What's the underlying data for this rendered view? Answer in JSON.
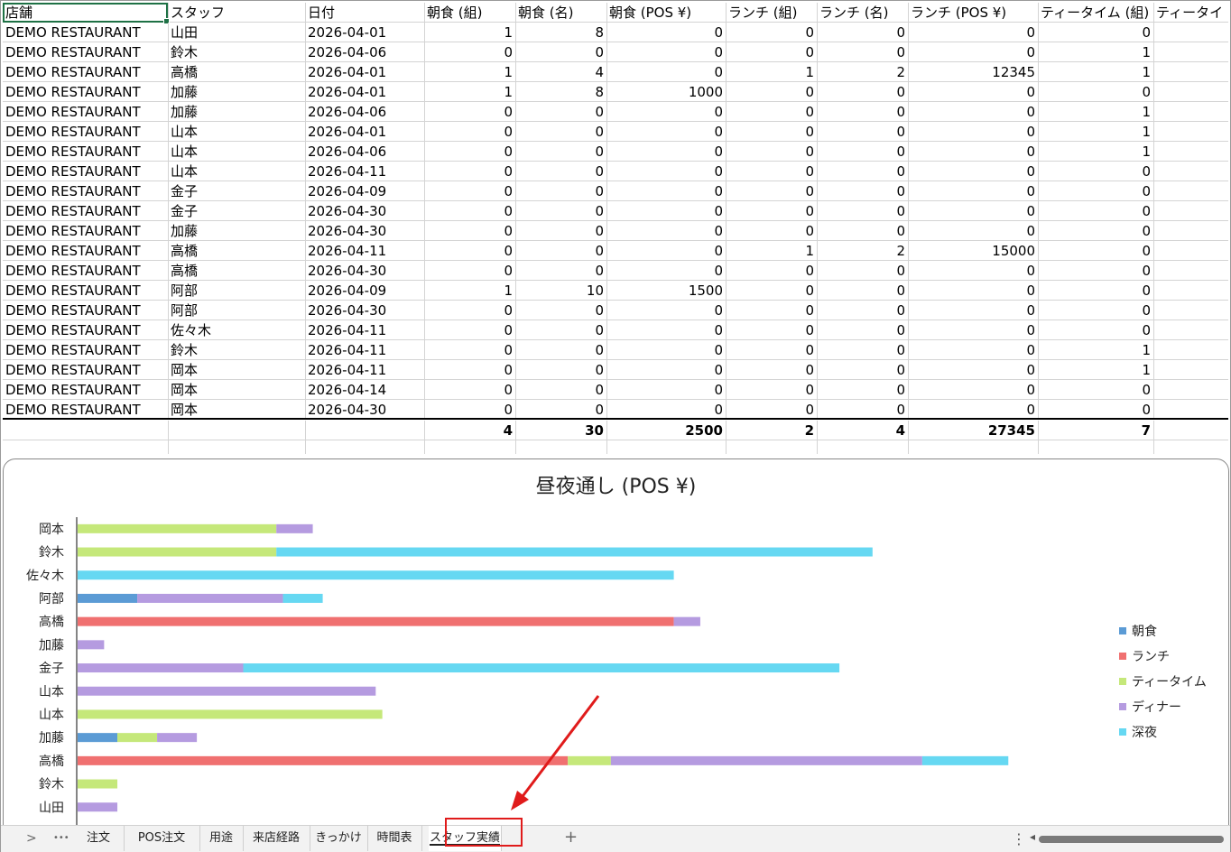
{
  "sheet": {
    "headers": [
      "店舗",
      "スタッフ",
      "日付",
      "朝食 (組)",
      "朝食 (名)",
      "朝食 (POS ¥)",
      "ランチ (組)",
      "ランチ (名)",
      "ランチ (POS ¥)",
      "ティータイム (組)",
      "ティータイ"
    ],
    "rows": [
      [
        "DEMO RESTAURANT",
        "山田",
        "2026-04-01",
        "1",
        "8",
        "0",
        "0",
        "0",
        "0",
        "0"
      ],
      [
        "DEMO RESTAURANT",
        "鈴木",
        "2026-04-06",
        "0",
        "0",
        "0",
        "0",
        "0",
        "0",
        "1"
      ],
      [
        "DEMO RESTAURANT",
        "高橋",
        "2026-04-01",
        "1",
        "4",
        "0",
        "1",
        "2",
        "12345",
        "1"
      ],
      [
        "DEMO RESTAURANT",
        "加藤",
        "2026-04-01",
        "1",
        "8",
        "1000",
        "0",
        "0",
        "0",
        "0"
      ],
      [
        "DEMO RESTAURANT",
        "加藤",
        "2026-04-06",
        "0",
        "0",
        "0",
        "0",
        "0",
        "0",
        "1"
      ],
      [
        "DEMO RESTAURANT",
        "山本",
        "2026-04-01",
        "0",
        "0",
        "0",
        "0",
        "0",
        "0",
        "1"
      ],
      [
        "DEMO RESTAURANT",
        "山本",
        "2026-04-06",
        "0",
        "0",
        "0",
        "0",
        "0",
        "0",
        "1"
      ],
      [
        "DEMO RESTAURANT",
        "山本",
        "2026-04-11",
        "0",
        "0",
        "0",
        "0",
        "0",
        "0",
        "0"
      ],
      [
        "DEMO RESTAURANT",
        "金子",
        "2026-04-09",
        "0",
        "0",
        "0",
        "0",
        "0",
        "0",
        "0"
      ],
      [
        "DEMO RESTAURANT",
        "金子",
        "2026-04-30",
        "0",
        "0",
        "0",
        "0",
        "0",
        "0",
        "0"
      ],
      [
        "DEMO RESTAURANT",
        "加藤",
        "2026-04-30",
        "0",
        "0",
        "0",
        "0",
        "0",
        "0",
        "0"
      ],
      [
        "DEMO RESTAURANT",
        "高橋",
        "2026-04-11",
        "0",
        "0",
        "0",
        "1",
        "2",
        "15000",
        "0"
      ],
      [
        "DEMO RESTAURANT",
        "高橋",
        "2026-04-30",
        "0",
        "0",
        "0",
        "0",
        "0",
        "0",
        "0"
      ],
      [
        "DEMO RESTAURANT",
        "阿部",
        "2026-04-09",
        "1",
        "10",
        "1500",
        "0",
        "0",
        "0",
        "0"
      ],
      [
        "DEMO RESTAURANT",
        "阿部",
        "2026-04-30",
        "0",
        "0",
        "0",
        "0",
        "0",
        "0",
        "0"
      ],
      [
        "DEMO RESTAURANT",
        "佐々木",
        "2026-04-11",
        "0",
        "0",
        "0",
        "0",
        "0",
        "0",
        "0"
      ],
      [
        "DEMO RESTAURANT",
        "鈴木",
        "2026-04-11",
        "0",
        "0",
        "0",
        "0",
        "0",
        "0",
        "1"
      ],
      [
        "DEMO RESTAURANT",
        "岡本",
        "2026-04-11",
        "0",
        "0",
        "0",
        "0",
        "0",
        "0",
        "1"
      ],
      [
        "DEMO RESTAURANT",
        "岡本",
        "2026-04-14",
        "0",
        "0",
        "0",
        "0",
        "0",
        "0",
        "0"
      ],
      [
        "DEMO RESTAURANT",
        "岡本",
        "2026-04-30",
        "0",
        "0",
        "0",
        "0",
        "0",
        "0",
        "0"
      ]
    ],
    "totals": [
      "4",
      "30",
      "2500",
      "2",
      "4",
      "27345",
      "7"
    ]
  },
  "chart_data": {
    "type": "bar",
    "orientation": "horizontal",
    "stacked": true,
    "title": "昼夜通し (POS ¥)",
    "categories": [
      "岡本",
      "鈴木",
      "佐々木",
      "阿部",
      "高橋",
      "加藤",
      "金子",
      "山本",
      "山本",
      "加藤",
      "高橋",
      "鈴木",
      "山田"
    ],
    "series": [
      {
        "name": "朝食",
        "color": "#5b9bd5",
        "values": [
          0,
          0,
          0,
          900,
          0,
          0,
          0,
          0,
          0,
          600,
          0,
          0,
          0
        ]
      },
      {
        "name": "ランチ",
        "color": "#f07070",
        "values": [
          0,
          0,
          0,
          0,
          9000,
          0,
          0,
          0,
          0,
          0,
          7400,
          0,
          0
        ]
      },
      {
        "name": "ティータイム",
        "color": "#c5e87a",
        "values": [
          3000,
          3000,
          0,
          0,
          0,
          0,
          0,
          0,
          4600,
          600,
          650,
          600,
          0
        ]
      },
      {
        "name": "ディナー",
        "color": "#b59be0",
        "values": [
          550,
          0,
          0,
          2200,
          400,
          400,
          2500,
          4500,
          0,
          600,
          4700,
          0,
          600
        ]
      },
      {
        "name": "深夜",
        "color": "#66d8f2",
        "values": [
          0,
          9000,
          9000,
          600,
          0,
          0,
          9000,
          0,
          0,
          0,
          1300,
          0,
          0
        ]
      }
    ],
    "xlim": [
      0,
      15000
    ],
    "grid": false,
    "legend": "right"
  },
  "tabs": {
    "nav_next": ">",
    "more": "•••",
    "items": [
      "注文",
      "POS注文",
      "用途",
      "来店経路",
      "きっかけ",
      "時間表",
      "スタッフ実績"
    ],
    "active": "スタッフ実績",
    "add": "+",
    "options": "⋮",
    "scroll_left": "◂"
  }
}
